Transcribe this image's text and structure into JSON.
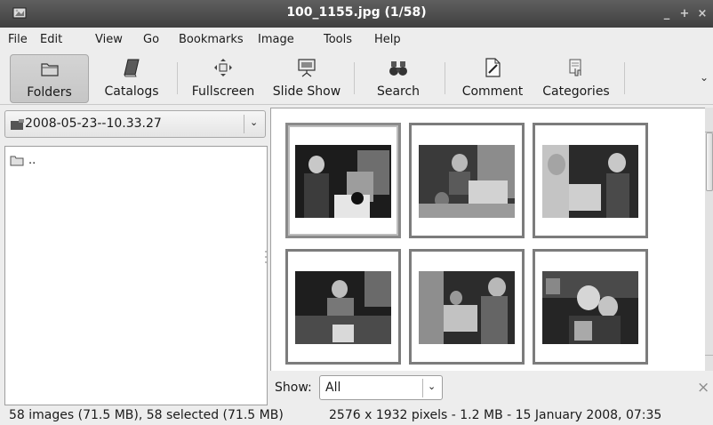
{
  "window": {
    "title": "100_1155.jpg  (1/58)",
    "controls": [
      "_",
      "+",
      "×"
    ]
  },
  "menu": [
    "File",
    "Edit",
    "View",
    "Go",
    "Bookmarks",
    "Image",
    "Tools",
    "Help"
  ],
  "toolbar": {
    "folders": "Folders",
    "catalogs": "Catalogs",
    "fullscreen": "Fullscreen",
    "slideshow": "Slide Show",
    "search": "Search",
    "comment": "Comment",
    "categories": "Categories",
    "overflow": "⌄"
  },
  "folder": {
    "current": "2008-05-23--10.33.27",
    "arrow": "⌄",
    "entries": [
      ".."
    ]
  },
  "thumbnails": [
    {
      "selected": true,
      "scene": "kids-table"
    },
    {
      "selected": false,
      "scene": "kids-gift"
    },
    {
      "selected": false,
      "scene": "girls-present"
    },
    {
      "selected": false,
      "scene": "boy-sofa"
    },
    {
      "selected": false,
      "scene": "children-group"
    },
    {
      "selected": false,
      "scene": "adult-child"
    }
  ],
  "filter": {
    "label": "Show:",
    "value": "All",
    "arrow": "⌄",
    "close": "×"
  },
  "status": {
    "left": "58 images (71.5 MB), 58 selected (71.5 MB)",
    "right": "2576 x 1932 pixels - 1.2 MB - 15 January 2008, 07:35"
  },
  "colors": {
    "titlebar": "#4f4f4f",
    "selection_border": "#8a8a8a"
  }
}
